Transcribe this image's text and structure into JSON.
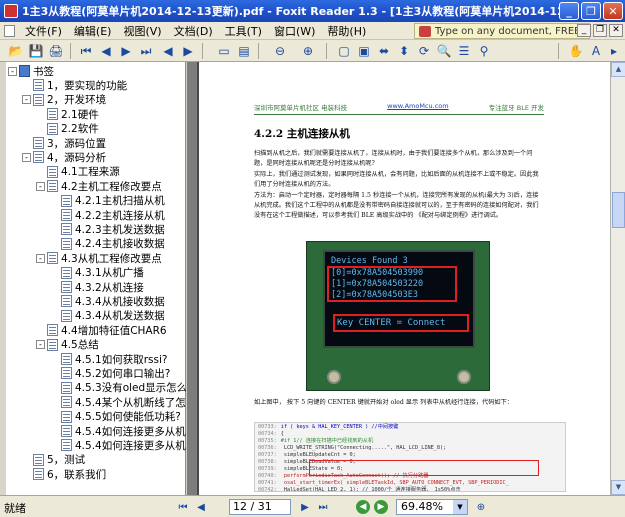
{
  "window": {
    "title": "1主3从教程(阿莫单片机2014-12-13更新).pdf - Foxit Reader 1.3 - [1主3从教程(阿莫单片机2014-12-1",
    "minimize": "_",
    "restore": "❐",
    "close": "✕"
  },
  "menu": {
    "items": [
      "文件(F)",
      "编辑(E)",
      "视图(V)",
      "文档(D)",
      "工具(T)",
      "窗口(W)",
      "帮助(H)"
    ],
    "promo": "Type on any document, FREE!"
  },
  "bookmarks": [
    {
      "label": "书签",
      "level": 0,
      "expander": "-",
      "book": true
    },
    {
      "label": "1，要实现的功能",
      "level": 1,
      "expander": ""
    },
    {
      "label": "2，开发环境",
      "level": 1,
      "expander": "-"
    },
    {
      "label": "2.1硬件",
      "level": 2,
      "expander": ""
    },
    {
      "label": "2.2软件",
      "level": 2,
      "expander": ""
    },
    {
      "label": "3，源码位置",
      "level": 1,
      "expander": ""
    },
    {
      "label": "4，源码分析",
      "level": 1,
      "expander": "-"
    },
    {
      "label": "4.1工程来源",
      "level": 2,
      "expander": ""
    },
    {
      "label": "4.2主机工程修改要点",
      "level": 2,
      "expander": "-"
    },
    {
      "label": "4.2.1主机扫描从机",
      "level": 3,
      "expander": ""
    },
    {
      "label": "4.2.2主机连接从机",
      "level": 3,
      "expander": ""
    },
    {
      "label": "4.2.3主机发送数据",
      "level": 3,
      "expander": ""
    },
    {
      "label": "4.2.4主机接收数据",
      "level": 3,
      "expander": ""
    },
    {
      "label": "4.3从机工程修改要点",
      "level": 2,
      "expander": "-"
    },
    {
      "label": "4.3.1从机广播",
      "level": 3,
      "expander": ""
    },
    {
      "label": "4.3.2从机连接",
      "level": 3,
      "expander": ""
    },
    {
      "label": "4.3.4从机接收数据",
      "level": 3,
      "expander": ""
    },
    {
      "label": "4.3.4从机发送数据",
      "level": 3,
      "expander": ""
    },
    {
      "label": "4.4增加特征值CHAR6",
      "level": 2,
      "expander": ""
    },
    {
      "label": "4.5总结",
      "level": 2,
      "expander": "-"
    },
    {
      "label": "4.5.1如何获取rssi?",
      "level": 3,
      "expander": ""
    },
    {
      "label": "4.5.2如何串口输出?",
      "level": 3,
      "expander": ""
    },
    {
      "label": "4.5.3没有oled显示怎么办?",
      "level": 3,
      "expander": ""
    },
    {
      "label": "4.5.4某个从机断线了怎么办",
      "level": 3,
      "expander": ""
    },
    {
      "label": "4.5.5如何使能低功耗?",
      "level": 3,
      "expander": ""
    },
    {
      "label": "4.5.4如何连接更多从机?",
      "level": 3,
      "expander": ""
    },
    {
      "label": "4.5.4如何连接更多从机?",
      "level": 3,
      "expander": ""
    },
    {
      "label": "5，测试",
      "level": 1,
      "expander": ""
    },
    {
      "label": "6，联系我们",
      "level": 1,
      "expander": ""
    }
  ],
  "pdf": {
    "header_left": "深圳市阿莫单片机社区  电装科技",
    "header_link": "www.AmoMcu.com",
    "header_right": "专注蓝牙 BLE 开发",
    "heading": "4.2.2 主机连接从机",
    "para1": "扫描到从机之后，我们就需要连接从机了，连接从机时，由于我们要连接多个从机，那么涉及到一个问题，是同时连接从机呢还是分时连接从机呢?",
    "para2": "实际上，我们通过测试发现，如果同时连接从机，会有问题，比如后面的从机连接不上或不稳定。因此我们用了分时连接从机的方法。",
    "para3": "方法为：启动一个定时器，定时器每隔 1.5 秒连接一个从机，连接完所有发现的从机(最大为 3)后，连接从机完成。我们这个工程中的从机都是没有带密码自接连接就可以的，至于有密码的连接如何配对，我们没有在这个工程做描述，可以参考我们 BLE 高级实战中的 《配对与绑定例程》进行调试。",
    "oled_lines": [
      "Devices Found 3",
      "[0]=0x78A504503990",
      "[1]=0x78A504503220",
      "[2]=0x78A504503E3",
      "Key CENTER = Connect"
    ],
    "caption": "如上图中， 按下 5 向键的 CENTER 键就开始对 oled 显示 列表中从机经行连接，代码如下：",
    "code": [
      {
        "num": "00733:",
        "text": "if ( keys & HAL_KEY_CENTER )  //中间按键"
      },
      {
        "num": "00734:",
        "text": "{"
      },
      {
        "num": "00735:",
        "text": "#if 1// 连接在扫描中已经找到的从机"
      },
      {
        "num": "00736:",
        "text": "  LCD_WRITE_STRING(\"Connecting.....\", HAL_LCD_LINE_8);"
      },
      {
        "num": "00737:",
        "text": "  simpleBLEUpdateCnt = 0;"
      },
      {
        "num": "00738:",
        "text": "  simpleBLEDeadValue = 0;"
      },
      {
        "num": "00739:",
        "text": "  simpleBLEState = 0;"
      },
      {
        "num": "00740:",
        "text": "  performPeriodicTask_AutoConnect();  // 执行分路器"
      },
      {
        "num": "00741:",
        "text": "  osal_start_timerEx( simpleBLETaskId, SBP_AUTO_CONNECT_EVT, SBP_PERIODIC_"
      },
      {
        "num": "00742:",
        "text": "  HalLedSet(HAL_LED_2, 1); // 1000/个 通连接服务器， 1s50%点击"
      },
      {
        "num": "00743:",
        "text": "#else"
      }
    ]
  },
  "status": {
    "text": "就绪",
    "page": "12 / 31",
    "zoom": "69.48%"
  }
}
